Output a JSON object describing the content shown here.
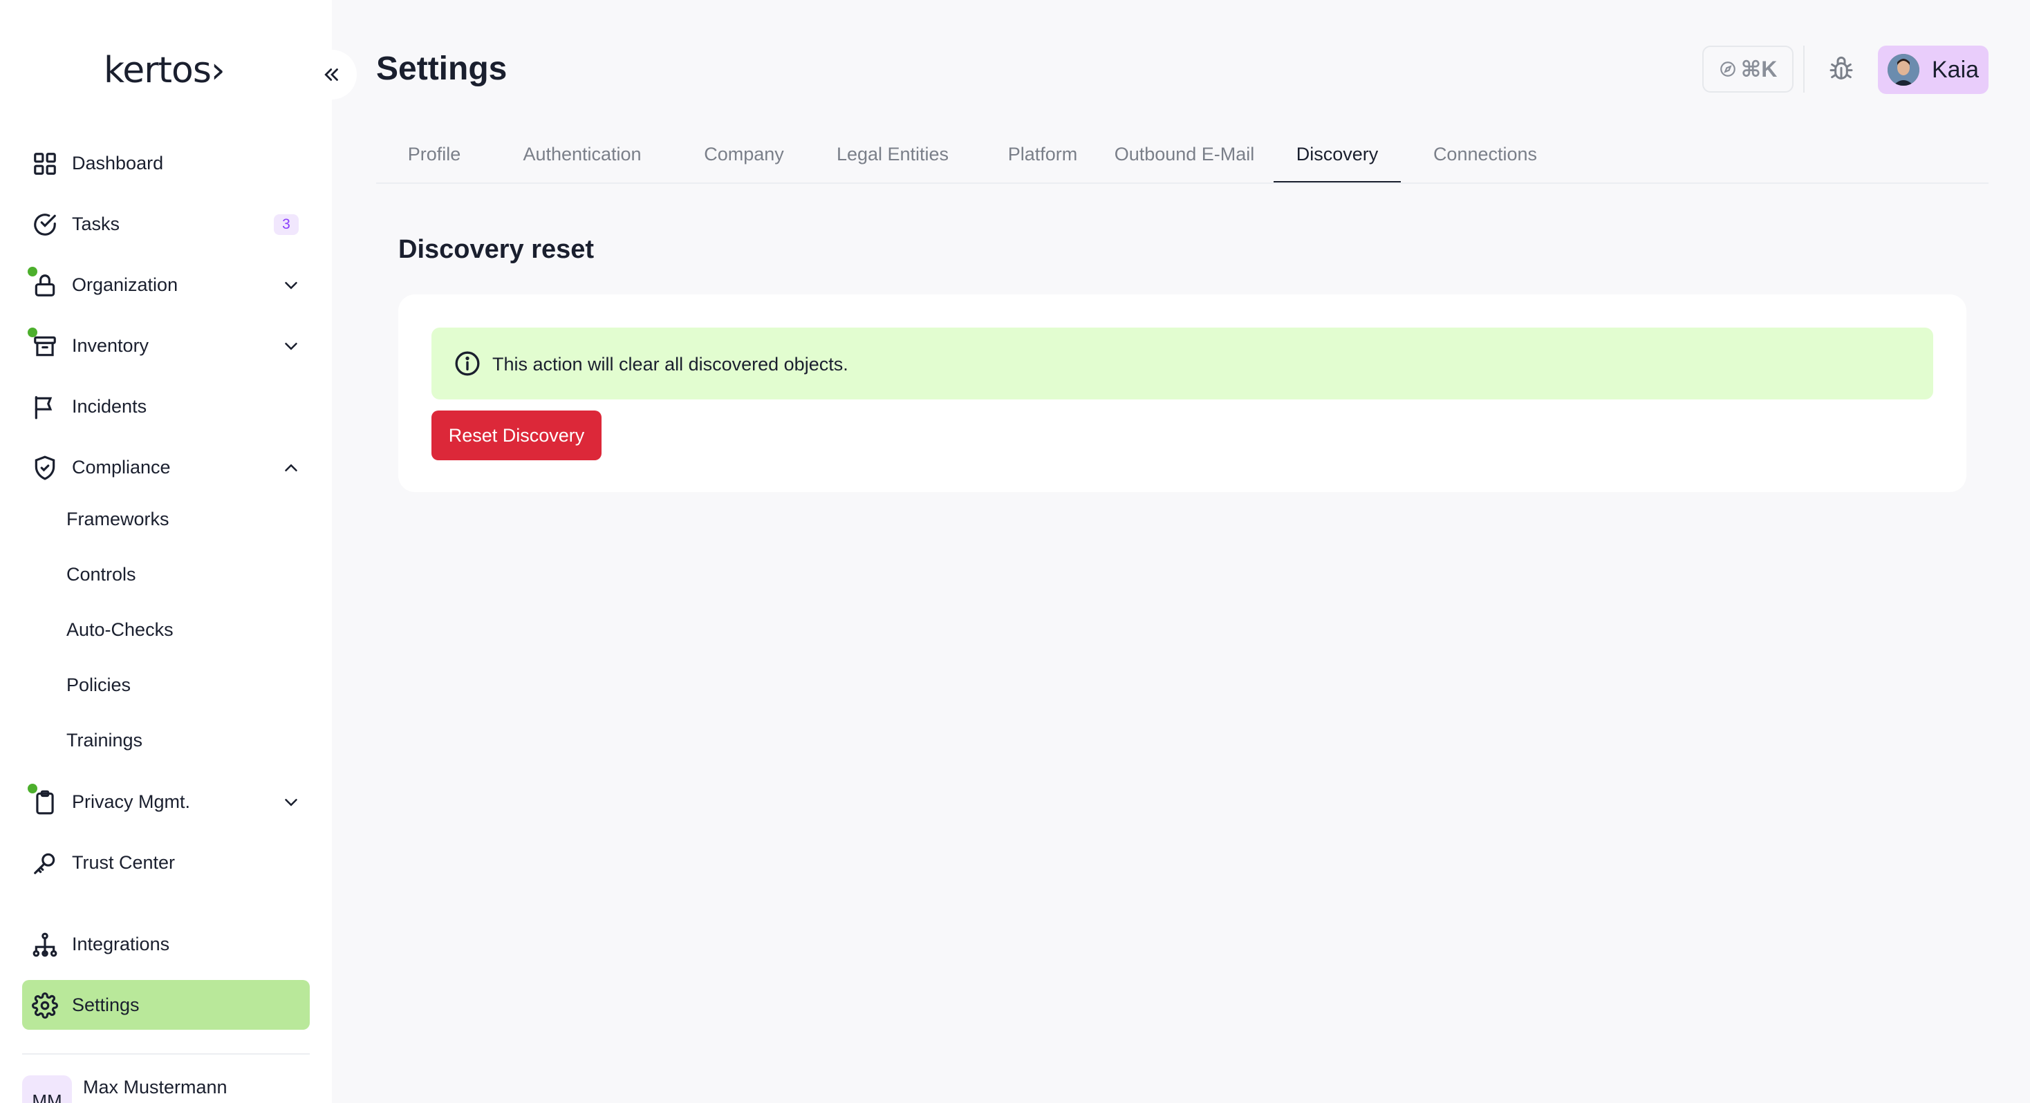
{
  "brand": {
    "logo_text": "kertos›"
  },
  "sidebar": {
    "items": [
      {
        "label": "Dashboard",
        "icon": "grid-icon"
      },
      {
        "label": "Tasks",
        "icon": "check-circle-icon",
        "badge": "3"
      },
      {
        "label": "Organization",
        "icon": "lock-icon",
        "dot": true,
        "expand": "chevron-down"
      },
      {
        "label": "Inventory",
        "icon": "archive-icon",
        "dot": true,
        "expand": "chevron-down"
      },
      {
        "label": "Incidents",
        "icon": "flag-icon"
      },
      {
        "label": "Compliance",
        "icon": "shield-check-icon",
        "expand": "chevron-up"
      },
      {
        "label": "Privacy Mgmt.",
        "icon": "clipboard-icon",
        "dot": true,
        "expand": "chevron-down"
      },
      {
        "label": "Trust Center",
        "icon": "key-icon"
      },
      {
        "label": "Integrations",
        "icon": "network-icon"
      },
      {
        "label": "Settings",
        "icon": "gear-icon",
        "active": true
      }
    ],
    "compliance_sub": [
      "Frameworks",
      "Controls",
      "Auto-Checks",
      "Policies",
      "Trainings"
    ],
    "user": {
      "initials": "MM",
      "name": "Max Mustermann"
    }
  },
  "header": {
    "title": "Settings",
    "command_shortcut": "⌘K",
    "user_chip_name": "Kaia"
  },
  "tabs": [
    {
      "label": "Profile"
    },
    {
      "label": "Authentication"
    },
    {
      "label": "Company"
    },
    {
      "label": "Legal Entities"
    },
    {
      "label": "Platform"
    },
    {
      "label": "Outbound E-Mail"
    },
    {
      "label": "Discovery",
      "active": true
    },
    {
      "label": "Connections"
    }
  ],
  "main": {
    "section_title": "Discovery reset",
    "alert_text": "This action will clear all discovered objects.",
    "reset_button_label": "Reset Discovery"
  },
  "colors": {
    "active_nav_bg": "#b9e89a",
    "alert_bg": "#e2fdd0",
    "danger": "#dc2839",
    "status_dot": "#4caf2c",
    "badge_text": "#8a3ffc",
    "user_chip_bg": "#e9cdfb"
  }
}
